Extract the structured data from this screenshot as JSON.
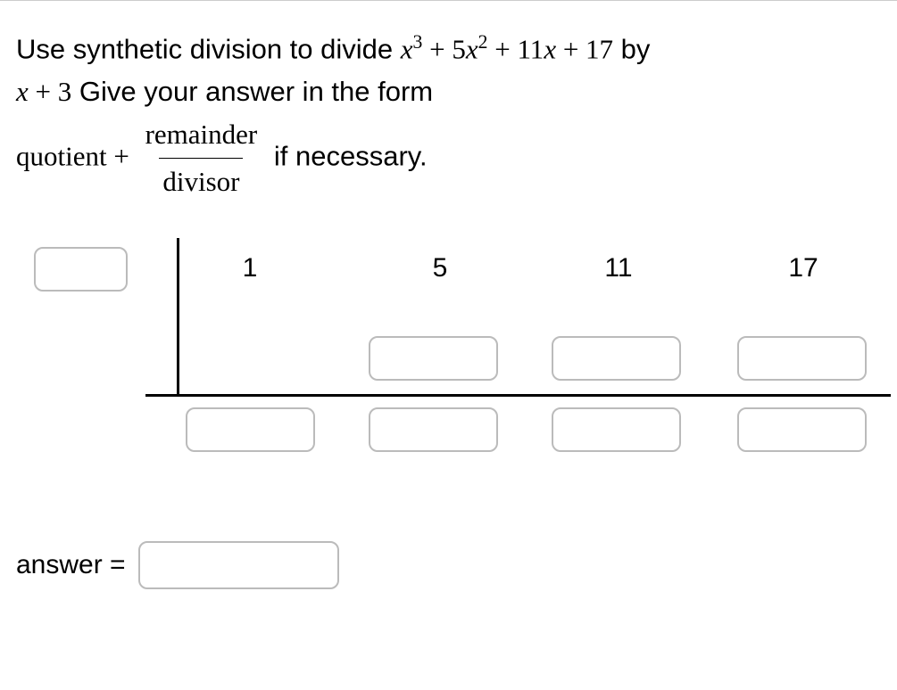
{
  "prompt": {
    "pre": "Use synthetic division to divide ",
    "poly_terms": [
      "x",
      "3",
      " + 5",
      "x",
      "2",
      " + 11",
      "x",
      " + 17"
    ],
    "by": " by ",
    "divisor": [
      "x",
      " + 3"
    ],
    "give": " Give your answer in the form",
    "quotient": "quotient",
    "plus": " + ",
    "frac_num": "remainder",
    "frac_den": "divisor",
    "ifnec": " if necessary."
  },
  "synthetic": {
    "coeffs": [
      "1",
      "5",
      "11",
      "17"
    ]
  },
  "answer_label": "answer ="
}
